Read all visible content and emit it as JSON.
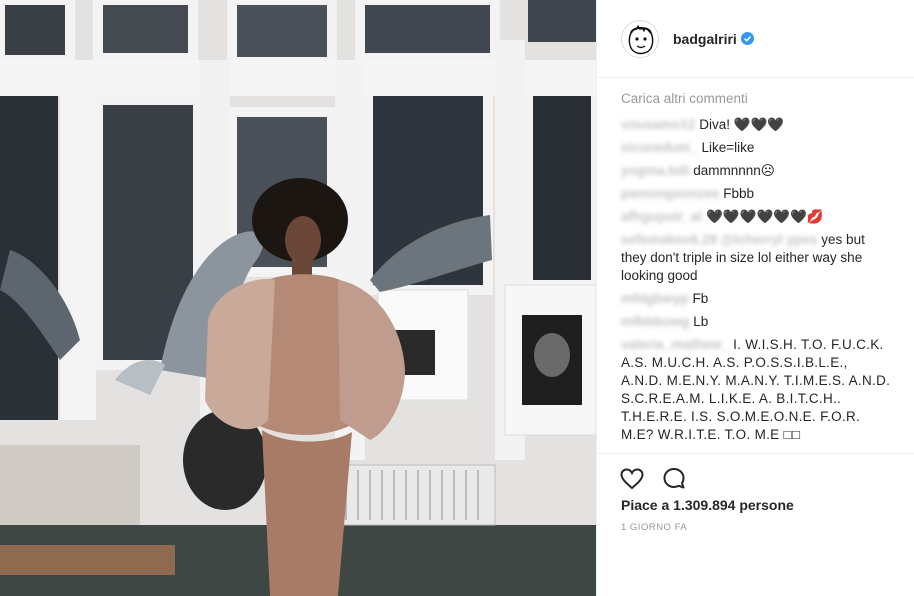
{
  "post": {
    "username": "badgalriri",
    "verified": true,
    "load_more": "Carica altri commenti",
    "comments": [
      {
        "user": "vousamo12",
        "text": "Diva! 🖤🖤🖤"
      },
      {
        "user": "nicoredum_",
        "text": "Like=like"
      },
      {
        "user": "yogma.bdt",
        "text": "dammnnnn☹"
      },
      {
        "user": "pamongsonzee",
        "text": "Fbbb"
      },
      {
        "user": "afhgupoir_al",
        "text": "🖤🖤🖤🖤🖤🖤💋"
      },
      {
        "user": "sefemakeo6.29 @lcherryl ypes",
        "text": "yes but they don't triple in size lol either way she looking good"
      },
      {
        "user": "mfdgbwyp",
        "text": "Fb"
      },
      {
        "user": "mfbbbuwg",
        "text": "Lb"
      },
      {
        "user": "valeria_mathew_",
        "text": "I. W.I.S.H. T.O. F.U.C.K. A.S. M.U.C.H. A.S. P.O.S.S.I.B.L.E., A.N.D. M.E.N.Y. M.A.N.Y. T.I.M.E.S. A.N.D. S.C.R.E.A.M. L.I.K.E. A. B.I.T.C.H.. T.H.E.R.E. I.S. S.O.M.E.O.N.E. F.O.R. M.E? W.R.I.T.E. T.O. M.E □□"
      }
    ],
    "likes_prefix": "Piace a",
    "likes_count": "1.309.894",
    "likes_suffix": "persone",
    "time": "1 GIORNO FA",
    "icons": {
      "like": "heart-icon",
      "comment": "comment-bubble-icon",
      "verified": "verified-badge-icon"
    },
    "colors": {
      "verified": "#3897f0",
      "muted": "#999999",
      "text": "#262626"
    }
  }
}
